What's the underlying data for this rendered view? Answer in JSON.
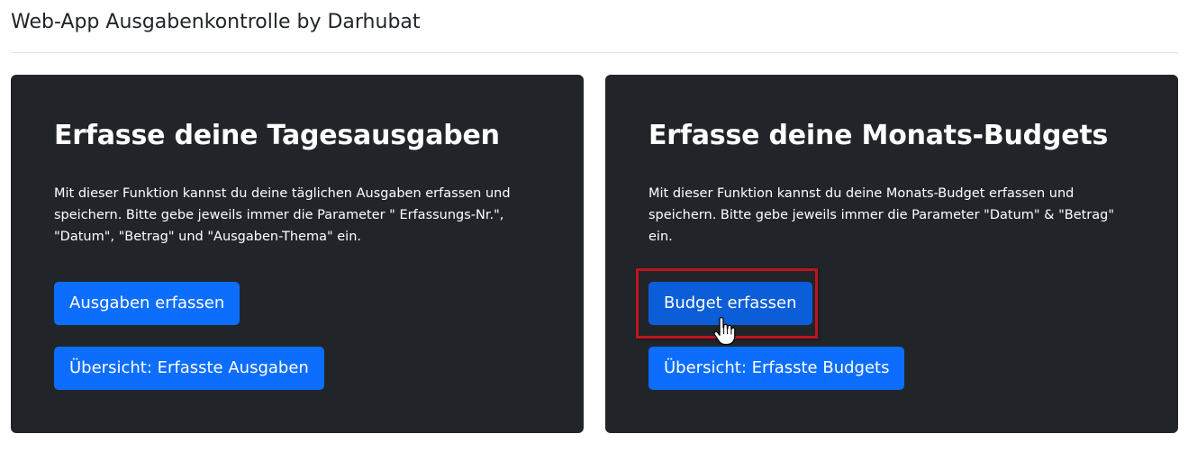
{
  "header": {
    "title": "Web-App Ausgabenkontrolle by Darhubat"
  },
  "cards": [
    {
      "title": "Erfasse deine Tagesausgaben",
      "text": "Mit dieser Funktion kannst du deine täglichen Ausgaben erfassen und speichern. Bitte gebe jeweils immer die Parameter \" Erfassungs-Nr.\", \"Datum\", \"Betrag\" und \"Ausgaben-Thema\" ein.",
      "primary_button": "Ausgaben erfassen",
      "secondary_button": "Übersicht: Erfasste Ausgaben"
    },
    {
      "title": "Erfasse deine Monats-Budgets",
      "text": "Mit dieser Funktion kannst du deine Monats-Budget erfassen und speichern. Bitte gebe jeweils immer die Parameter \"Datum\" & \"Betrag\" ein.",
      "primary_button": "Budget erfassen",
      "secondary_button": "Übersicht: Erfasste Budgets"
    }
  ],
  "colors": {
    "card_background": "#212529",
    "button_primary": "#0d6efd",
    "button_hover": "#0b5ed7",
    "highlight": "#c0141c"
  },
  "overlay": {
    "cursor_icon": "hand-pointer-icon",
    "highlight_target": "Budget erfassen"
  }
}
